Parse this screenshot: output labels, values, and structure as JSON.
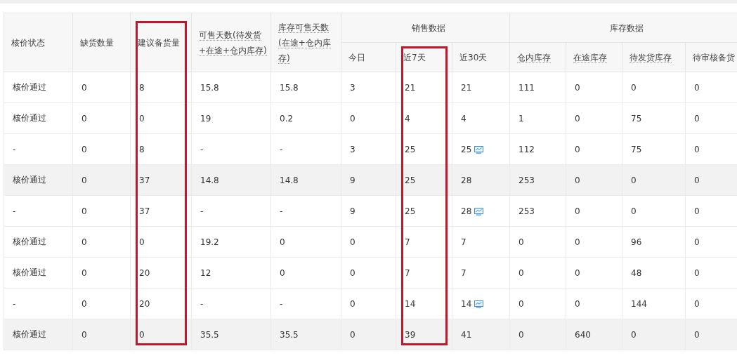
{
  "table": {
    "header": [
      {
        "kind": "single",
        "label": "核价状态",
        "hint": false,
        "marked": false
      },
      {
        "kind": "single",
        "label": "缺货数量",
        "hint": false,
        "marked": false
      },
      {
        "kind": "single",
        "label": "建议备货量",
        "hint": false,
        "marked": true
      },
      {
        "kind": "single",
        "label": "可售天数(待发货+在途+仓内库存)",
        "hint": true,
        "marked": false
      },
      {
        "kind": "single",
        "label": "库存可售天数(在途+仓内库存)",
        "hint": true,
        "marked": false
      },
      {
        "kind": "group",
        "label": "销售数据",
        "columns": [
          {
            "label": "今日",
            "hint": false,
            "marked": false
          },
          {
            "label": "近7天",
            "hint": false,
            "marked": true
          },
          {
            "label": "近30天",
            "hint": false,
            "marked": false
          }
        ]
      },
      {
        "kind": "group",
        "label": "库存数据",
        "columns": [
          {
            "label": "仓内库存",
            "hint": true,
            "marked": false
          },
          {
            "label": "在途库存",
            "hint": true,
            "marked": false
          },
          {
            "label": "待发货库存",
            "hint": true,
            "marked": false
          },
          {
            "label": "待审核备货",
            "hint": false,
            "marked": false
          }
        ]
      }
    ],
    "rows": [
      {
        "highlighted": false,
        "trend": false,
        "cells": [
          "核价通过",
          "0",
          "8",
          "15.8",
          "15.8",
          "3",
          "21",
          "21",
          "111",
          "0",
          "0",
          "0"
        ]
      },
      {
        "highlighted": false,
        "trend": false,
        "cells": [
          "核价通过",
          "0",
          "0",
          "19",
          "0.2",
          "0",
          "4",
          "4",
          "1",
          "0",
          "75",
          "0"
        ]
      },
      {
        "highlighted": false,
        "trend": true,
        "cells": [
          "-",
          "0",
          "8",
          "-",
          "-",
          "3",
          "25",
          "25",
          "112",
          "0",
          "75",
          "0"
        ]
      },
      {
        "highlighted": true,
        "trend": false,
        "cells": [
          "核价通过",
          "0",
          "37",
          "14.8",
          "14.8",
          "9",
          "25",
          "28",
          "253",
          "0",
          "0",
          "0"
        ]
      },
      {
        "highlighted": false,
        "trend": true,
        "cells": [
          "-",
          "0",
          "37",
          "-",
          "-",
          "9",
          "25",
          "28",
          "253",
          "0",
          "0",
          "0"
        ]
      },
      {
        "highlighted": false,
        "trend": false,
        "cells": [
          "核价通过",
          "0",
          "0",
          "19.2",
          "0",
          "0",
          "7",
          "7",
          "0",
          "0",
          "96",
          "0"
        ]
      },
      {
        "highlighted": false,
        "trend": false,
        "cells": [
          "核价通过",
          "0",
          "20",
          "12",
          "0",
          "0",
          "7",
          "7",
          "0",
          "0",
          "48",
          "0"
        ]
      },
      {
        "highlighted": false,
        "trend": true,
        "cells": [
          "-",
          "0",
          "20",
          "-",
          "-",
          "0",
          "14",
          "14",
          "0",
          "0",
          "144",
          "0"
        ]
      },
      {
        "highlighted": true,
        "trend": false,
        "cells": [
          "核价通过",
          "0",
          "0",
          "35.5",
          "35.5",
          "0",
          "39",
          "41",
          "0",
          "640",
          "0",
          "0"
        ]
      }
    ]
  }
}
